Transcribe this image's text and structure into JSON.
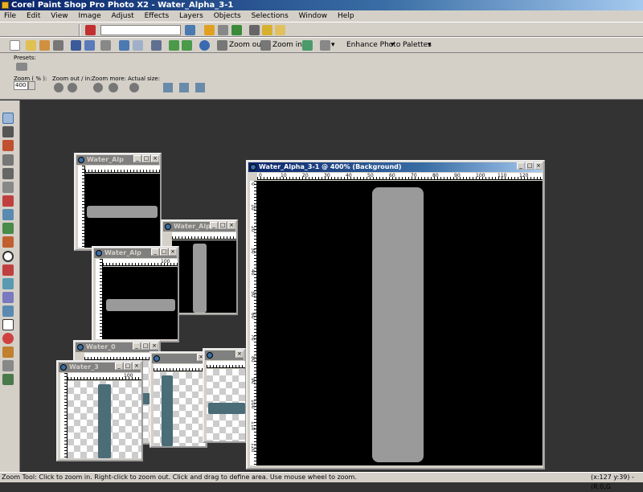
{
  "app": {
    "title": "Corel Paint Shop Pro Photo X2 - Water_Alpha_3-1"
  },
  "menu": [
    "File",
    "Edit",
    "View",
    "Image",
    "Adjust",
    "Effects",
    "Layers",
    "Objects",
    "Selections",
    "Window",
    "Help"
  ],
  "toolbar2": {
    "zoom_out_label": "Zoom out",
    "zoom_in_label": "Zoom in",
    "enhance_photo_label": "Enhance Photo",
    "palettes_label": "Palettes"
  },
  "options": {
    "presets_label": "Presets:",
    "zoom_label": "Zoom ( % ):",
    "zoom_value": "400",
    "zoom_out_in_label": "Zoom out / in:",
    "zoom_more_label": "Zoom more:",
    "actual_size_label": "Actual size:"
  },
  "windows": {
    "main_title": "Water_Alpha_3-1 @ 400% (Background)",
    "w1_title": "Water_Alp",
    "w2_title": "Water_Alp",
    "w3_title": "Water_Alp",
    "w4_title": "Water_0",
    "w5_title": "Water_3",
    "main_ruler_labels": [
      "0",
      "10",
      "20",
      "30",
      "40",
      "50",
      "60",
      "70",
      "80",
      "90",
      "100",
      "110",
      "120"
    ],
    "main_vruler_labels": [
      "0",
      "10",
      "20",
      "30",
      "40",
      "50",
      "60",
      "70",
      "80",
      "90",
      "100",
      "110",
      "120"
    ],
    "small_ruler_label": "100"
  },
  "status": {
    "message": "Zoom Tool: Click to zoom in. Right-click to zoom out. Click and drag to define area. Use mouse wheel to zoom.",
    "coords": "(x:127 y:39) - (R:0,G"
  },
  "colors": {
    "workspace": "#333333",
    "chrome": "#d4d0c8",
    "title_active": "#0a246a",
    "shape_gray": "#9a9a9a",
    "shape_teal": "#4a6d78"
  }
}
